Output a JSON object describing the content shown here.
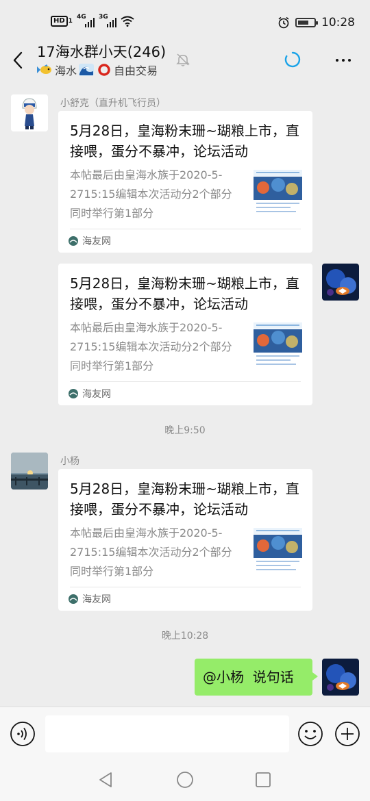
{
  "status_bar": {
    "network_badge": "HD",
    "sim_badge": "1",
    "sig1_net": "4G",
    "sig2_net": "3G",
    "time": "10:28",
    "battery_level": 0.7
  },
  "header": {
    "title": "17海水群小天(246)",
    "subtitle_text1": "海水",
    "subtitle_text2": "自由交易",
    "icons": [
      "back-arrow-icon",
      "fish-emoji",
      "wave-emoji",
      "ring-emoji",
      "bell-muted-icon",
      "loading-icon",
      "more-icon"
    ]
  },
  "messages": [
    {
      "sender": "小舒克（直升机飞行员）",
      "card": {
        "title": "5月28日，皇海粉末珊~瑚粮上市，直接喂，蛋分不暴冲，论坛活动",
        "desc": "本帖最后由皇海水族于2020-5-2715:15编辑本次活动分2个部分同时举行第1部分",
        "source": "海友网"
      }
    },
    {
      "sender": "",
      "card": {
        "title": "5月28日，皇海粉末珊~瑚粮上市，直接喂，蛋分不暴冲，论坛活动",
        "desc": "本帖最后由皇海水族于2020-5-2715:15编辑本次活动分2个部分同时举行第1部分",
        "source": "海友网"
      }
    },
    {
      "sender": "小杨",
      "card": {
        "title": "5月28日，皇海粉末珊~瑚粮上市，直接喂，蛋分不暴冲，论坛活动",
        "desc": "本帖最后由皇海水族于2020-5-2715:15编辑本次活动分2个部分同时举行第1部分",
        "source": "海友网"
      }
    }
  ],
  "timestamps": [
    "晚上9:50",
    "晚上10:28"
  ],
  "my_message": "@小杨  说句话",
  "input": {
    "value": "",
    "placeholder": ""
  },
  "colors": {
    "my_bubble": "#95ec69",
    "accent": "#1aa3e8",
    "background": "#ededed"
  }
}
